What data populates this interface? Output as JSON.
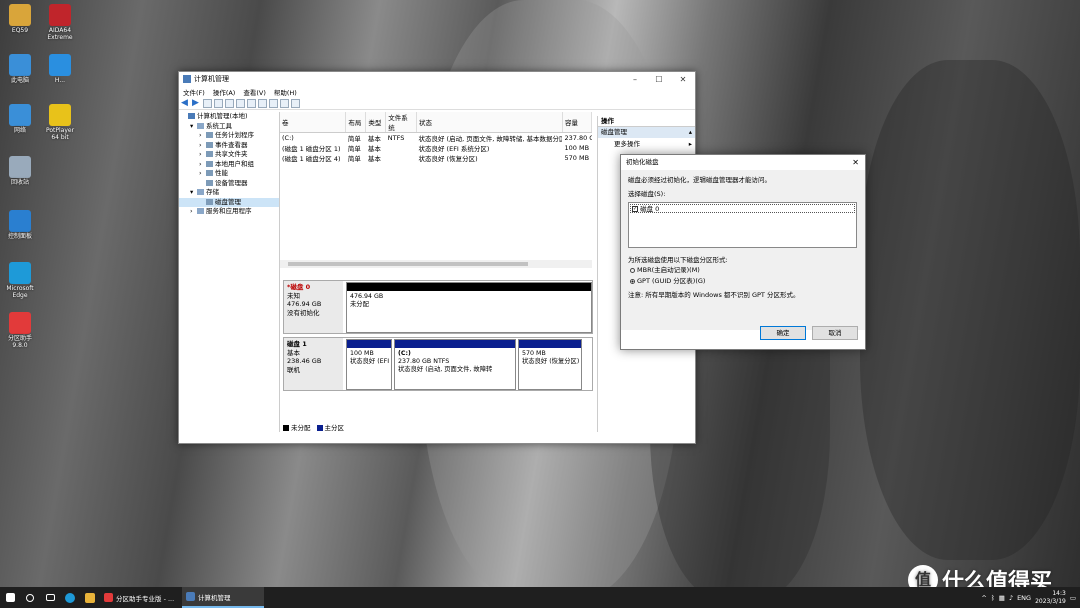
{
  "desktop": {
    "icons": [
      {
        "label": "EQ59",
        "color": "#d9a53a"
      },
      {
        "label": "AIDA64 Extreme",
        "color": "#c0252b"
      },
      {
        "label": "此电脑",
        "color": "#3a8fd8"
      },
      {
        "label": "H...",
        "color": "#2a8fe0"
      },
      {
        "label": "网络",
        "color": "#3a8fd8"
      },
      {
        "label": "PotPlayer 64 bit",
        "color": "#e8c21a"
      },
      {
        "label": "回收站",
        "color": "#9ab"
      },
      {
        "label": "控制面板",
        "color": "#2a7fd0"
      },
      {
        "label": "Microsoft Edge",
        "color": "#1e9ad8"
      },
      {
        "label": "分区助手 9.8.0",
        "color": "#e23a3a"
      }
    ]
  },
  "main_window": {
    "title": "计算机管理",
    "menu": [
      "文件(F)",
      "操作(A)",
      "查看(V)",
      "帮助(H)"
    ],
    "tree": [
      {
        "label": "计算机管理(本地)",
        "level": 0,
        "expander": ""
      },
      {
        "label": "系统工具",
        "level": 1,
        "expander": "▾"
      },
      {
        "label": "任务计划程序",
        "level": 2,
        "expander": "›"
      },
      {
        "label": "事件查看器",
        "level": 2,
        "expander": "›"
      },
      {
        "label": "共享文件夹",
        "level": 2,
        "expander": "›"
      },
      {
        "label": "本地用户和组",
        "level": 2,
        "expander": "›"
      },
      {
        "label": "性能",
        "level": 2,
        "expander": "›"
      },
      {
        "label": "设备管理器",
        "level": 2,
        "expander": ""
      },
      {
        "label": "存储",
        "level": 1,
        "expander": "▾"
      },
      {
        "label": "磁盘管理",
        "level": 2,
        "expander": "",
        "selected": true
      },
      {
        "label": "服务和应用程序",
        "level": 1,
        "expander": "›"
      }
    ],
    "volume_table": {
      "columns": [
        "卷",
        "布局",
        "类型",
        "文件系统",
        "状态",
        "容量"
      ],
      "rows": [
        [
          "(C:)",
          "简单",
          "基本",
          "NTFS",
          "状态良好 (启动, 页面文件, 故障转储, 基本数据分区)",
          "237.80 G"
        ],
        [
          "(磁盘 1 磁盘分区 1)",
          "简单",
          "基本",
          "",
          "状态良好 (EFI 系统分区)",
          "100 MB"
        ],
        [
          "(磁盘 1 磁盘分区 4)",
          "简单",
          "基本",
          "",
          "状态良好 (恢复分区)",
          "570 MB"
        ]
      ]
    },
    "disks": [
      {
        "name": "*磁盘 0",
        "type": "未知",
        "size": "476.94 GB",
        "status": "没有初始化",
        "partitions": [
          {
            "size": "476.94 GB",
            "desc": "未分配",
            "kind": "unallocated"
          }
        ]
      },
      {
        "name": "磁盘 1",
        "type": "基本",
        "size": "238.46 GB",
        "status": "联机",
        "partitions": [
          {
            "name": "",
            "size": "100 MB",
            "desc": "状态良好 (EFI",
            "kind": "primary"
          },
          {
            "name": "(C:)",
            "size": "237.80 GB NTFS",
            "desc": "状态良好 (启动, 页面文件, 故障转",
            "kind": "primary"
          },
          {
            "name": "",
            "size": "570 MB",
            "desc": "状态良好 (恢复分区)",
            "kind": "primary"
          }
        ]
      }
    ],
    "legend": [
      {
        "label": "未分配",
        "color": "#000000"
      },
      {
        "label": "主分区",
        "color": "#0a1f8f"
      }
    ],
    "actions": {
      "header": "操作",
      "section": "磁盘管理",
      "more": "更多操作"
    }
  },
  "dialog": {
    "title": "初始化磁盘",
    "intro": "磁盘必须经过初始化，逻辑磁盘管理器才能访问。",
    "select_label": "选择磁盘(S):",
    "disk_item": "磁盘 0",
    "style_label": "为所选磁盘使用以下磁盘分区形式:",
    "options": [
      {
        "label": "MBR(主启动记录)(M)",
        "selected": false
      },
      {
        "label": "GPT (GUID 分区表)(G)",
        "selected": true
      }
    ],
    "note": "注意: 所有早期版本的 Windows 都不识别 GPT 分区形式。",
    "ok": "确定",
    "cancel": "取消"
  },
  "taskbar": {
    "tasks": [
      {
        "label": "分区助手专业版 - ...",
        "active": false,
        "color": "#e23a3a"
      },
      {
        "label": "计算机管理",
        "active": true,
        "color": "#4a7bb8"
      }
    ],
    "lang": "ENG",
    "time": "14:3",
    "date": "2023/3/19"
  },
  "watermark": {
    "text": "什么值得买",
    "logo": "值"
  },
  "colors": {
    "primary_partition": "#0a1f8f",
    "unallocated": "#000000",
    "accent": "#0078d7"
  }
}
